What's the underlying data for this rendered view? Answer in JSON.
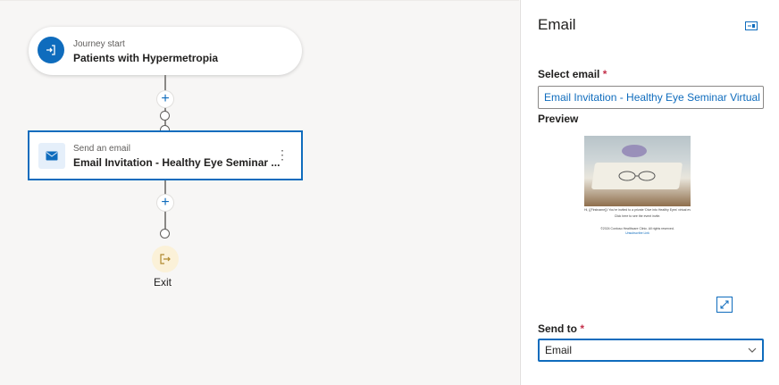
{
  "canvas": {
    "start_node": {
      "subtitle": "Journey start",
      "title": "Patients with Hypermetropia"
    },
    "email_node": {
      "subtitle": "Send an email",
      "title": "Email Invitation - Healthy Eye Seminar ...",
      "menu_glyph": "⋮"
    },
    "exit_label": "Exit",
    "plus_glyph": "+"
  },
  "panel": {
    "title": "Email",
    "select_email": {
      "label": "Select email",
      "required_mark": "*",
      "value": "Email Invitation - Healthy Eye Seminar Virtual E..."
    },
    "preview": {
      "label": "Preview",
      "line1": "Hi, {{Firstname}}! You’re invited to a private ‘Dive into Healthy Eyes’ virtual event.",
      "line2": "Click here to see the event invite.",
      "footer1": "©2024 Contoso Healthcare Clinic. All rights reserved.",
      "footer2": "Unsubscribe Link"
    },
    "send_to": {
      "label": "Send to",
      "required_mark": "*",
      "value": "Email"
    }
  },
  "colors": {
    "accent": "#0f6cbd",
    "exit_bg": "#fbf1d8",
    "required": "#c4314b"
  }
}
